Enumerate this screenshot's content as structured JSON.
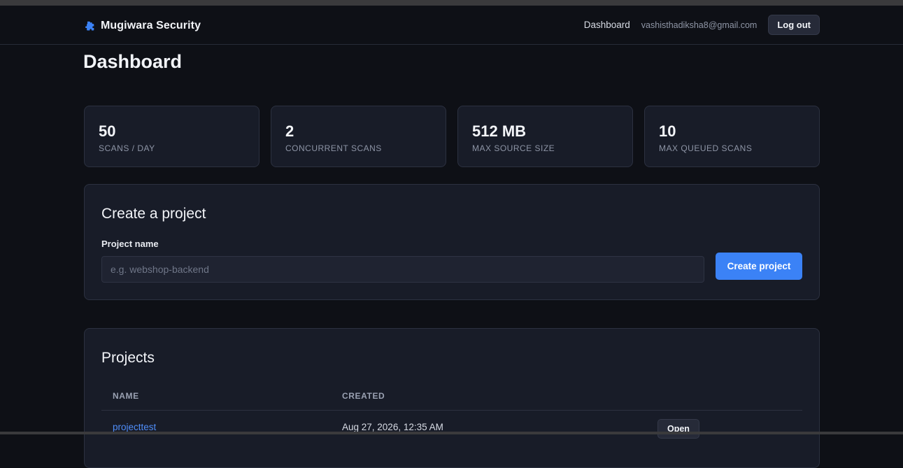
{
  "navbar": {
    "brand": "Mugiwara Security",
    "brand_icon": "puzzle-icon",
    "links": [
      "Dashboard"
    ],
    "email": "vashisthadiksha8@gmail.com",
    "logout_label": "Log out"
  },
  "page_title": "Dashboard",
  "stats": [
    {
      "value": "50",
      "label": "SCANS / DAY"
    },
    {
      "value": "2",
      "label": "CONCURRENT SCANS"
    },
    {
      "value": "512 MB",
      "label": "MAX SOURCE SIZE"
    },
    {
      "value": "10",
      "label": "MAX QUEUED SCANS"
    }
  ],
  "create_project": {
    "title": "Create a project",
    "field_label": "Project name",
    "placeholder": "e.g. webshop-backend",
    "value": "",
    "button_label": "Create project"
  },
  "projects": {
    "title": "Projects",
    "columns": [
      "NAME",
      "CREATED"
    ],
    "rows": [
      {
        "name": "projecttest",
        "created": "Aug 27, 2026, 12:35 AM",
        "action": "Open"
      }
    ]
  },
  "colors": {
    "accent": "#3b82f6",
    "link": "#4f8df8",
    "background": "#0e1016",
    "card": "#181c28"
  }
}
